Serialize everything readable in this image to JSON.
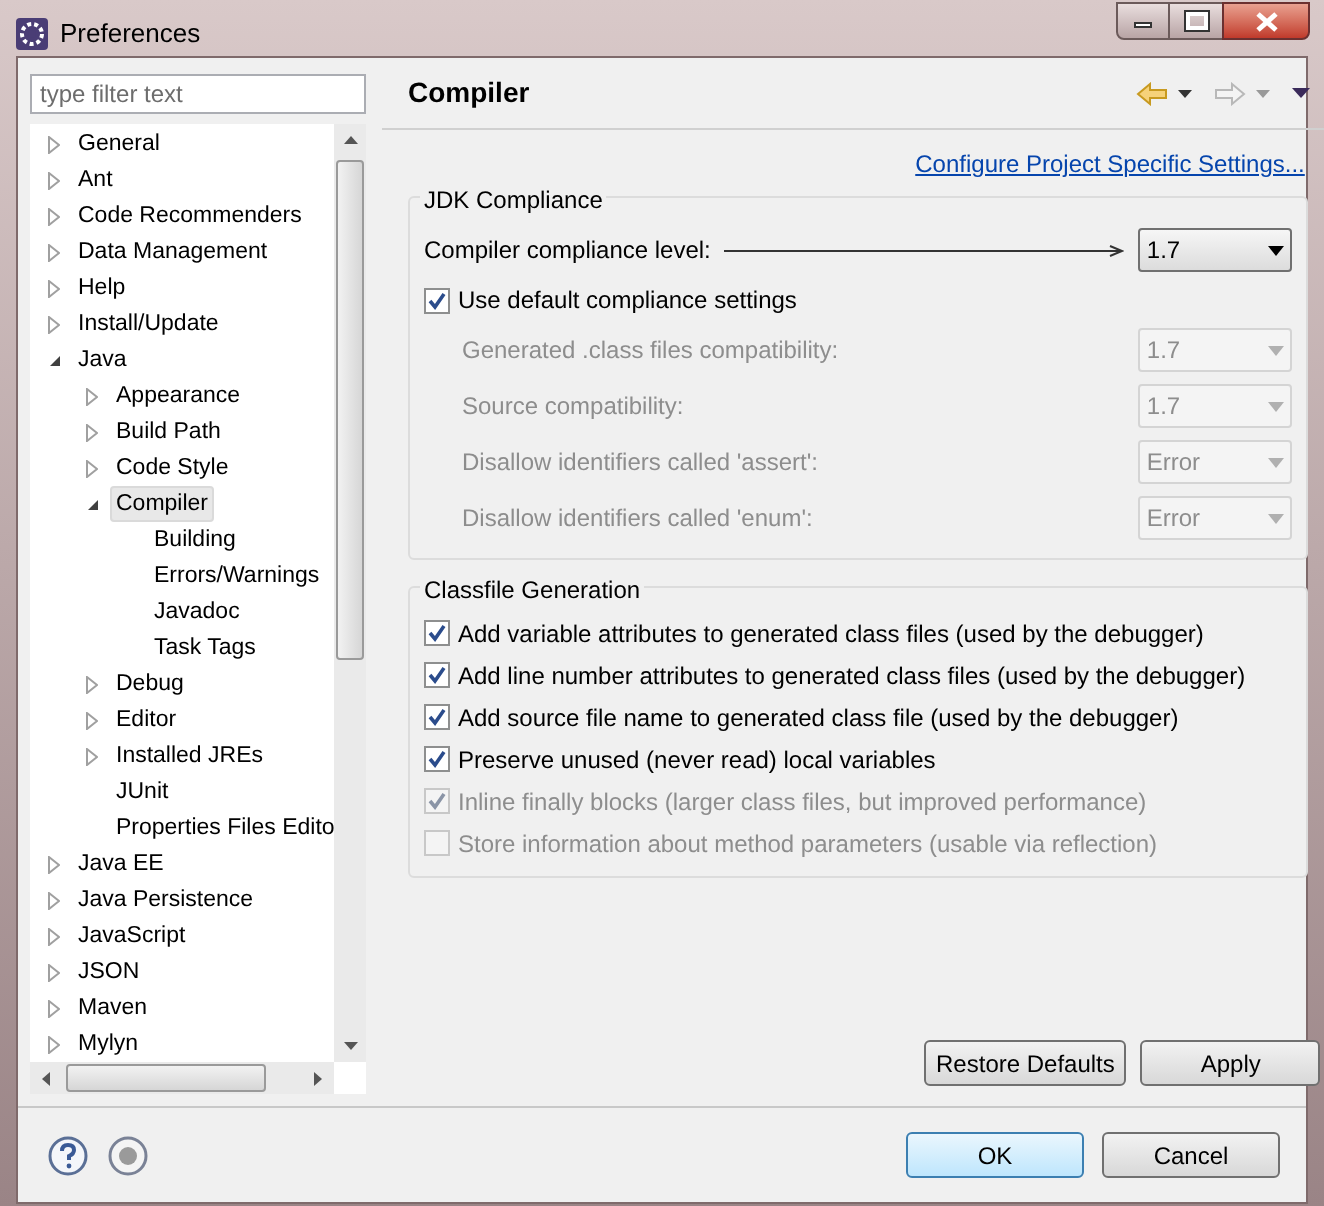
{
  "window": {
    "title": "Preferences"
  },
  "filter": {
    "placeholder": "type filter text"
  },
  "tree": [
    {
      "label": "General",
      "expanded": false,
      "selected": false
    },
    {
      "label": "Ant",
      "expanded": false,
      "selected": false
    },
    {
      "label": "Code Recommenders",
      "expanded": false,
      "selected": false
    },
    {
      "label": "Data Management",
      "expanded": false,
      "selected": false
    },
    {
      "label": "Help",
      "expanded": false,
      "selected": false
    },
    {
      "label": "Install/Update",
      "expanded": false,
      "selected": false
    },
    {
      "label": "Java",
      "expanded": true,
      "selected": false,
      "children": [
        {
          "label": "Appearance",
          "expanded": false,
          "selected": false
        },
        {
          "label": "Build Path",
          "expanded": false,
          "selected": false
        },
        {
          "label": "Code Style",
          "expanded": false,
          "selected": false
        },
        {
          "label": "Compiler",
          "expanded": true,
          "selected": true,
          "children": [
            {
              "label": "Building",
              "selected": false
            },
            {
              "label": "Errors/Warnings",
              "selected": false
            },
            {
              "label": "Javadoc",
              "selected": false
            },
            {
              "label": "Task Tags",
              "selected": false
            }
          ]
        },
        {
          "label": "Debug",
          "expanded": false,
          "selected": false
        },
        {
          "label": "Editor",
          "expanded": false,
          "selected": false
        },
        {
          "label": "Installed JREs",
          "expanded": false,
          "selected": false
        },
        {
          "label": "JUnit",
          "selected": false
        },
        {
          "label": "Properties Files Edito",
          "selected": false
        }
      ]
    },
    {
      "label": "Java EE",
      "expanded": false,
      "selected": false
    },
    {
      "label": "Java Persistence",
      "expanded": false,
      "selected": false
    },
    {
      "label": "JavaScript",
      "expanded": false,
      "selected": false
    },
    {
      "label": "JSON",
      "expanded": false,
      "selected": false
    },
    {
      "label": "Maven",
      "expanded": false,
      "selected": false
    },
    {
      "label": "Mylyn",
      "expanded": false,
      "selected": false
    }
  ],
  "page": {
    "title": "Compiler",
    "link": "Configure Project Specific Settings..."
  },
  "jdk_compliance": {
    "title": "JDK Compliance",
    "compliance_level": {
      "label": "Compiler compliance level:",
      "value": "1.7"
    },
    "use_default": {
      "label": "Use default compliance settings",
      "checked": true
    },
    "settings": [
      {
        "label": "Generated .class files compatibility:",
        "value": "1.7",
        "disabled": true
      },
      {
        "label": "Source compatibility:",
        "value": "1.7",
        "disabled": true
      },
      {
        "label": "Disallow identifiers called 'assert':",
        "value": "Error",
        "disabled": true
      },
      {
        "label": "Disallow identifiers called 'enum':",
        "value": "Error",
        "disabled": true
      }
    ]
  },
  "classfile_generation": {
    "title": "Classfile Generation",
    "options": [
      {
        "label": "Add variable attributes to generated class files (used by the debugger)",
        "checked": true,
        "disabled": false
      },
      {
        "label": "Add line number attributes to generated class files (used by the debugger)",
        "checked": true,
        "disabled": false
      },
      {
        "label": "Add source file name to generated class file (used by the debugger)",
        "checked": true,
        "disabled": false
      },
      {
        "label": "Preserve unused (never read) local variables",
        "checked": true,
        "disabled": false
      },
      {
        "label": "Inline finally blocks (larger class files, but improved performance)",
        "checked": true,
        "disabled": true
      },
      {
        "label": "Store information about method parameters (usable via reflection)",
        "checked": false,
        "disabled": true
      }
    ]
  },
  "page_buttons": [
    "Restore Defaults",
    "Apply"
  ],
  "dialog_buttons": [
    {
      "label": "OK",
      "default": true
    },
    {
      "label": "Cancel",
      "default": false
    }
  ]
}
